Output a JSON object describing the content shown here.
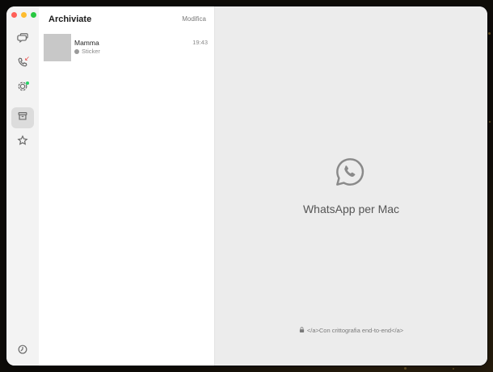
{
  "window": {
    "traffic_lights": {
      "close": "#ff5f57",
      "minimize": "#febc2e",
      "maximize": "#28c840"
    }
  },
  "rail": {
    "items": [
      {
        "name": "chats",
        "icon": "chat-bubbles-icon"
      },
      {
        "name": "calls",
        "icon": "phone-icon",
        "missed": true
      },
      {
        "name": "status",
        "icon": "status-ring-icon",
        "badge": true
      },
      {
        "name": "archived",
        "icon": "archive-icon",
        "active": true
      },
      {
        "name": "starred",
        "icon": "star-icon"
      }
    ],
    "bottom": {
      "name": "settings",
      "icon": "settings-icon"
    }
  },
  "list": {
    "title": "Archiviate",
    "edit_label": "Modifica",
    "chats": [
      {
        "name": "Mamma",
        "time": "19:43",
        "preview": "Sticker"
      }
    ]
  },
  "main": {
    "title": "WhatsApp per Mac",
    "encryption_note": "</a>Con crittografia end-to-end</a>"
  },
  "colors": {
    "accent_green": "#25d366",
    "missed_red": "#e53935"
  }
}
